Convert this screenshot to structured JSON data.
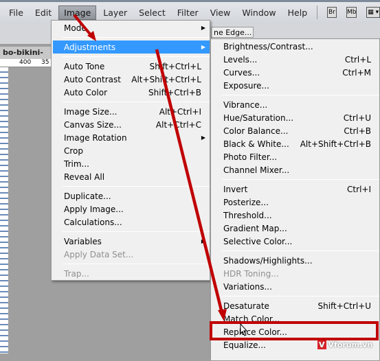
{
  "menubar": {
    "items": [
      "File",
      "Edit",
      "Image",
      "Layer",
      "Select",
      "Filter",
      "View",
      "Window",
      "Help"
    ],
    "active": "Image",
    "app_buttons": [
      "Br",
      "Mb"
    ]
  },
  "toolbar": {
    "refine_edge": "ne Edge..."
  },
  "document": {
    "tab": "bo-bikini-sea",
    "ruler": [
      "400",
      "35"
    ]
  },
  "image_menu": [
    {
      "label": "Mode",
      "submenu": true
    },
    {
      "sep": true
    },
    {
      "label": "Adjustments",
      "submenu": true,
      "highlighted": true
    },
    {
      "sep": true
    },
    {
      "label": "Auto Tone",
      "shortcut": "Shift+Ctrl+L"
    },
    {
      "label": "Auto Contrast",
      "shortcut": "Alt+Shift+Ctrl+L"
    },
    {
      "label": "Auto Color",
      "shortcut": "Shift+Ctrl+B"
    },
    {
      "sep": true
    },
    {
      "label": "Image Size...",
      "shortcut": "Alt+Ctrl+I"
    },
    {
      "label": "Canvas Size...",
      "shortcut": "Alt+Ctrl+C"
    },
    {
      "label": "Image Rotation",
      "submenu": true
    },
    {
      "label": "Crop"
    },
    {
      "label": "Trim..."
    },
    {
      "label": "Reveal All"
    },
    {
      "sep": true
    },
    {
      "label": "Duplicate..."
    },
    {
      "label": "Apply Image..."
    },
    {
      "label": "Calculations..."
    },
    {
      "sep": true
    },
    {
      "label": "Variables",
      "submenu": true
    },
    {
      "label": "Apply Data Set...",
      "disabled": true
    },
    {
      "sep": true
    },
    {
      "label": "Trap...",
      "disabled": true
    }
  ],
  "adjustments_menu": [
    {
      "label": "Brightness/Contrast..."
    },
    {
      "label": "Levels...",
      "shortcut": "Ctrl+L"
    },
    {
      "label": "Curves...",
      "shortcut": "Ctrl+M"
    },
    {
      "label": "Exposure..."
    },
    {
      "sep": true
    },
    {
      "label": "Vibrance..."
    },
    {
      "label": "Hue/Saturation...",
      "shortcut": "Ctrl+U"
    },
    {
      "label": "Color Balance...",
      "shortcut": "Ctrl+B"
    },
    {
      "label": "Black & White...",
      "shortcut": "Alt+Shift+Ctrl+B"
    },
    {
      "label": "Photo Filter..."
    },
    {
      "label": "Channel Mixer..."
    },
    {
      "sep": true
    },
    {
      "label": "Invert",
      "shortcut": "Ctrl+I"
    },
    {
      "label": "Posterize..."
    },
    {
      "label": "Threshold..."
    },
    {
      "label": "Gradient Map..."
    },
    {
      "label": "Selective Color..."
    },
    {
      "sep": true
    },
    {
      "label": "Shadows/Highlights..."
    },
    {
      "label": "HDR Toning...",
      "disabled": true
    },
    {
      "label": "Variations..."
    },
    {
      "sep": true
    },
    {
      "label": "Desaturate",
      "shortcut": "Shift+Ctrl+U"
    },
    {
      "label": "Match Color..."
    },
    {
      "label": "Replace Color...",
      "callout": true
    },
    {
      "label": "Equalize..."
    }
  ],
  "annotation_color": "#c00000",
  "watermark": "Vforum.vn"
}
